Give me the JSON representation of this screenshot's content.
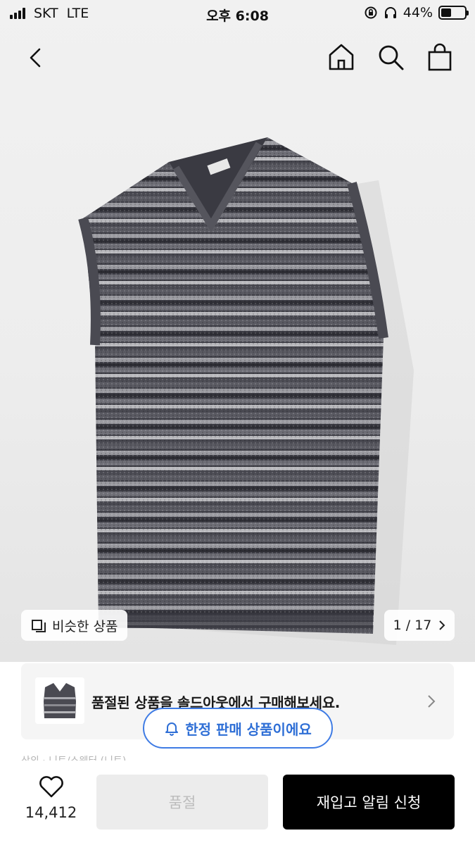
{
  "status_bar": {
    "carrier": "SKT",
    "network": "LTE",
    "time": "오후 6:08",
    "battery_percent": "44%",
    "battery_level": 0.44
  },
  "nav": {
    "back_icon": "chevron-left-icon",
    "icons": [
      "home-icon",
      "search-icon",
      "shopping-bag-icon"
    ]
  },
  "gallery": {
    "similar_label": "비슷한 상품",
    "counter": "1 / 17"
  },
  "soldout_banner": {
    "message": "품절된 상품을 솔드아웃에서 구매해보세요."
  },
  "limited_badge": {
    "label": "한정 판매 상품이에요",
    "color": "#2f6fd6"
  },
  "partial_text": "상의 · 니트/스웨터 (니트)",
  "bottom_bar": {
    "like_count": "14,412",
    "soldout_label": "품절",
    "restock_label": "재입고 알림 신청"
  },
  "colors": {
    "primary_button": "#000000",
    "accent": "#3e7be4"
  }
}
